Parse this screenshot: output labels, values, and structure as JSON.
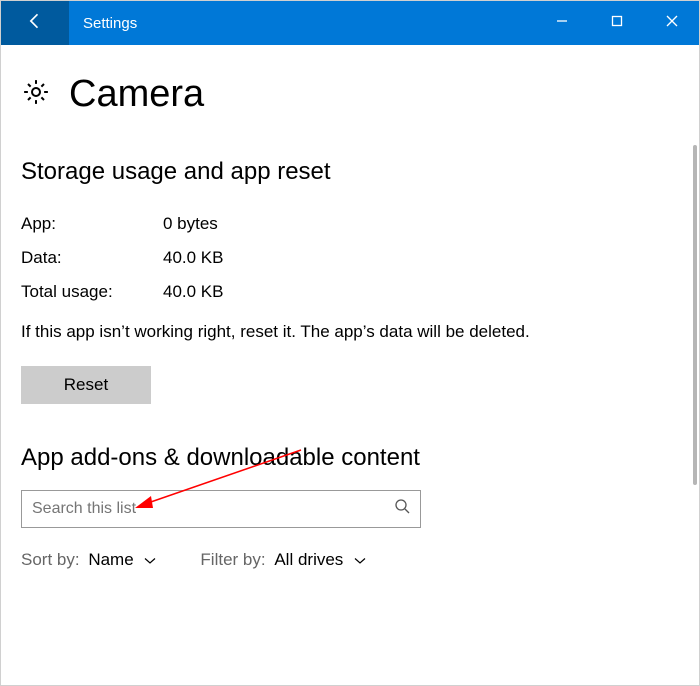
{
  "titlebar": {
    "back_name": "back-arrow-icon",
    "title": "Settings",
    "minimize_name": "minimize-icon",
    "maximize_name": "maximize-icon",
    "close_name": "close-icon"
  },
  "header": {
    "gear_name": "gear-icon",
    "title": "Camera"
  },
  "storage": {
    "section_title": "Storage usage and app reset",
    "app_label": "App:",
    "app_value": "0 bytes",
    "data_label": "Data:",
    "data_value": "40.0 KB",
    "total_label": "Total usage:",
    "total_value": "40.0 KB",
    "reset_desc": "If this app isn’t working right, reset it. The app’s data will be deleted.",
    "reset_button": "Reset"
  },
  "addons": {
    "section_title": "App add-ons & downloadable content",
    "search_placeholder": "Search this list",
    "search_icon": "search-icon",
    "sort_label": "Sort by:",
    "sort_value": "Name",
    "filter_label": "Filter by:",
    "filter_value": "All drives"
  }
}
